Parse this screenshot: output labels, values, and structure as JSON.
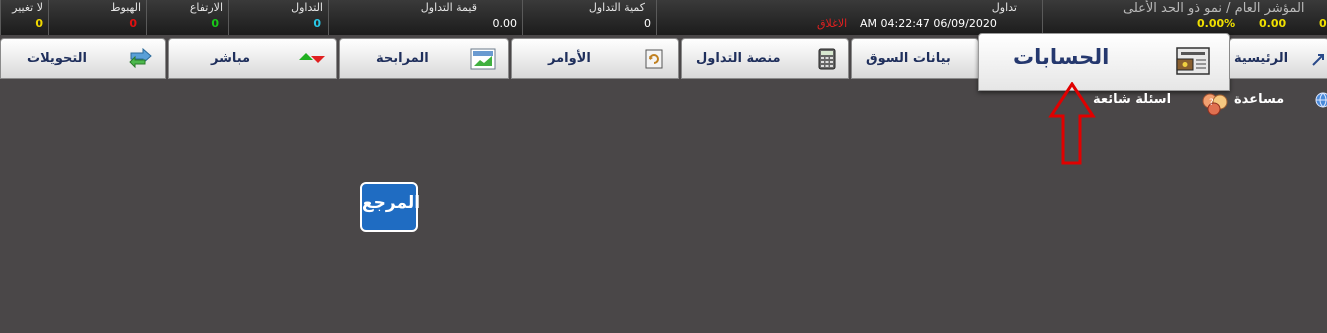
{
  "ticker": {
    "no_change": {
      "label": "لا تغيير",
      "value": "0"
    },
    "down": {
      "label": "الهبوط",
      "value": "0"
    },
    "up": {
      "label": "الارتفاع",
      "value": "0"
    },
    "trades": {
      "label": "التداول",
      "value": "0"
    },
    "turnover": {
      "label": "قيمة التداول",
      "value": "0.00"
    },
    "volume": {
      "label": "كمية التداول",
      "value": "0"
    },
    "status_label": "تداول",
    "datetime": "AM 04:22:47 06/09/2020",
    "market_status": "الاغلاق",
    "index_label": "المؤشر العام / نمو ذو الحد الأعلى",
    "index_values": [
      "0.00%",
      "0.00",
      "0"
    ]
  },
  "colors": {
    "no_change": "#f0d800",
    "down": "#e01010",
    "up": "#18c818",
    "trades": "#28c8e8",
    "neutral": "#ffffff",
    "closed": "#e02020",
    "index": "#f0e000",
    "tab_text": "#1f2f5c",
    "logo_bg": "#1f6cc2"
  },
  "tabs": [
    {
      "id": "transfers",
      "label": "التحويلات",
      "icon": "transfer-arrows-icon"
    },
    {
      "id": "live",
      "label": "مباشر",
      "icon": "up-down-arrows-icon"
    },
    {
      "id": "murabaha",
      "label": "المرابحة",
      "icon": "chart-image-icon"
    },
    {
      "id": "orders",
      "label": "الأوامر",
      "icon": "order-refresh-icon"
    },
    {
      "id": "trading",
      "label": "منصة التداول",
      "icon": "calculator-icon"
    },
    {
      "id": "market",
      "label": "بيانات السوق",
      "icon": ""
    },
    {
      "id": "accounts",
      "label": "الحسابات",
      "icon": "wallet-icon"
    },
    {
      "id": "home",
      "label": "الرئيسية",
      "icon": "home-arrow-icon"
    }
  ],
  "help": {
    "label": "مساعدة",
    "faq": "اسئلة شائعة"
  },
  "logo": {
    "text": "المرجع"
  }
}
